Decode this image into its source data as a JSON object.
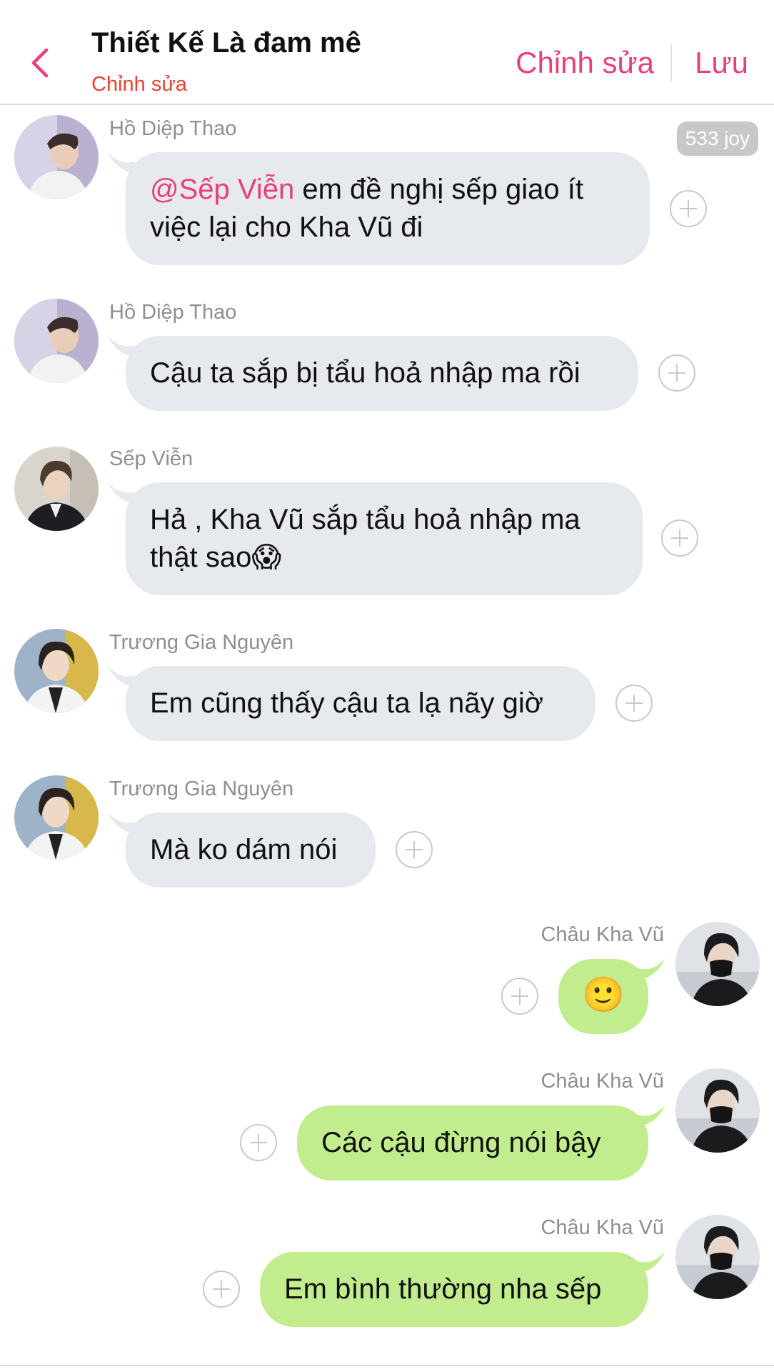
{
  "header": {
    "title": "Thiết Kế Là đam mê",
    "subtitle": "Chỉnh sửa",
    "edit_label": "Chỉnh sửa",
    "save_label": "Lưu",
    "accent_color": "#e8407a"
  },
  "joy_badge": "533 joy",
  "messages": [
    {
      "sender": "Hồ Diệp Thao",
      "mention": "@Sếp Viễn",
      "text_line1": " em đề nghị sếp giao ít",
      "text_line2": "việc lại cho Kha Vũ đi",
      "direction": "in"
    },
    {
      "sender": "Hồ Diệp Thao",
      "text": "Cậu ta sắp bị tẩu hoả nhập ma rồi",
      "direction": "in"
    },
    {
      "sender": "Sếp Viễn",
      "text_line1": "Hả , Kha Vũ sắp tẩu hoả nhập ma",
      "text_line2": "thật sao",
      "emoji": "😱",
      "direction": "in"
    },
    {
      "sender": "Trương Gia Nguyên",
      "text": "Em cũng thấy cậu ta lạ nãy giờ",
      "direction": "in"
    },
    {
      "sender": "Trương Gia Nguyên",
      "text": "Mà ko dám nói",
      "direction": "in"
    },
    {
      "sender": "Châu Kha Vũ",
      "emoji": "🙂",
      "direction": "out"
    },
    {
      "sender": "Châu Kha Vũ",
      "text": "Các cậu đừng nói bậy",
      "direction": "out"
    },
    {
      "sender": "Châu Kha Vũ",
      "text": "Em bình thường nha sếp",
      "direction": "out"
    }
  ]
}
